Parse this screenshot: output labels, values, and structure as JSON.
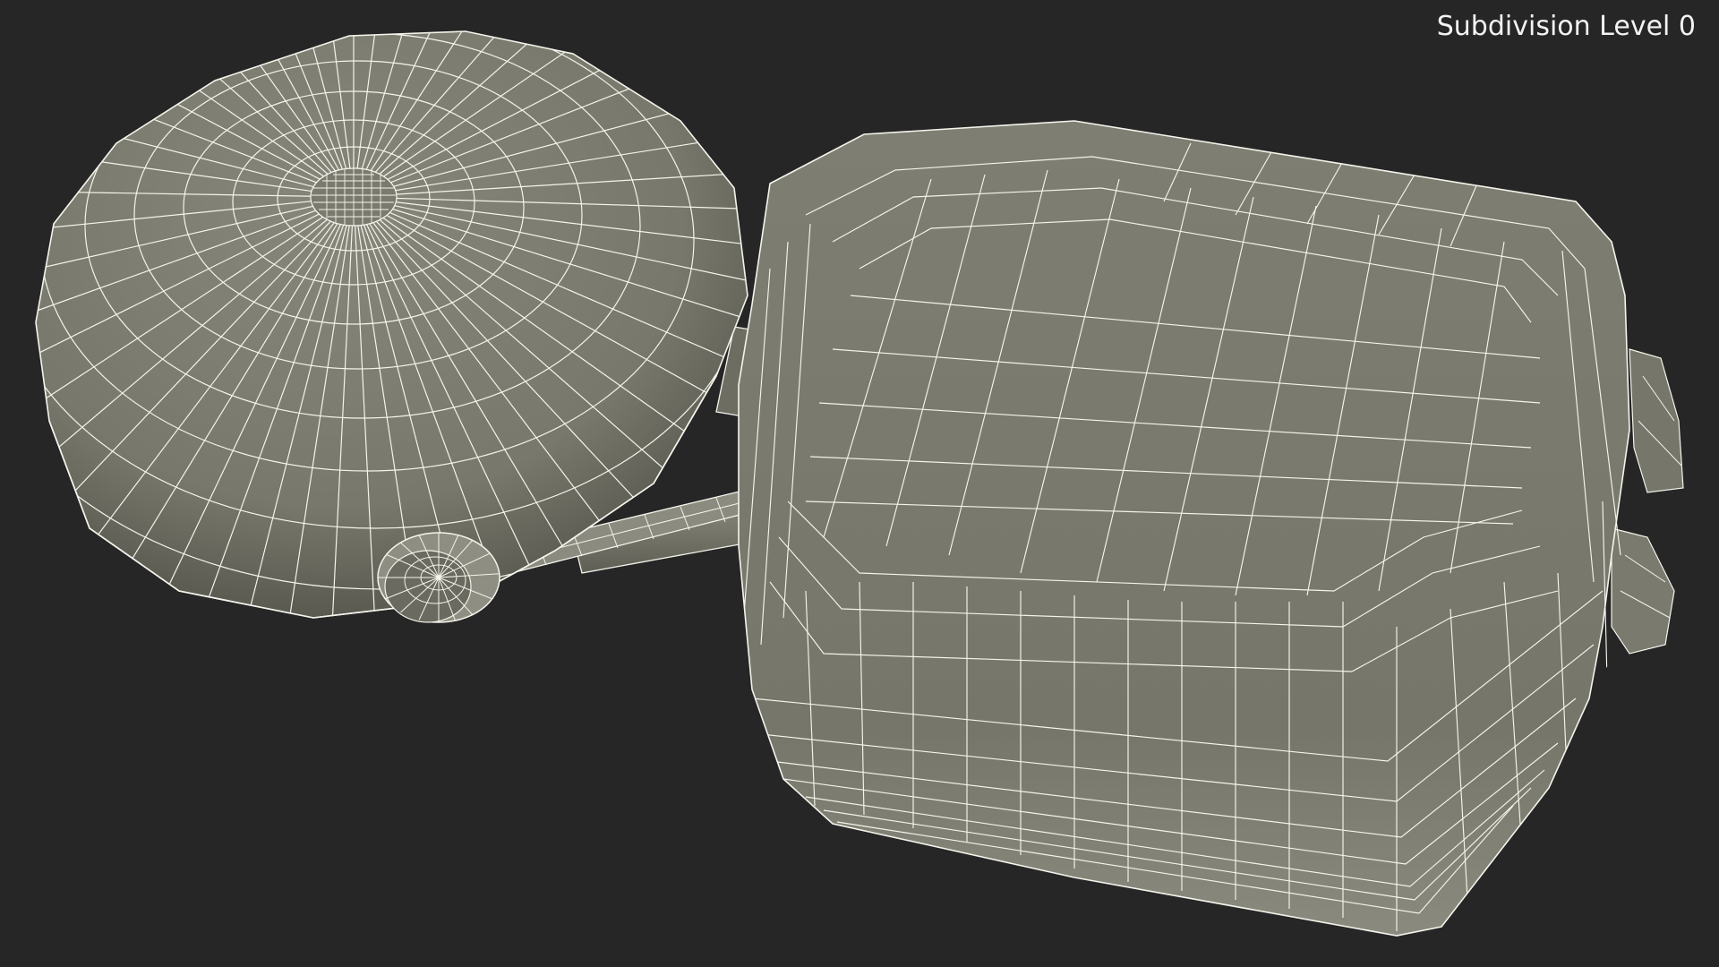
{
  "viewport": {
    "label": "Subdivision Level 0",
    "background": "#262626",
    "mesh_fill": "#7c7c70",
    "mesh_shade": "#55554c",
    "wire_color": "#f4f4ec"
  }
}
